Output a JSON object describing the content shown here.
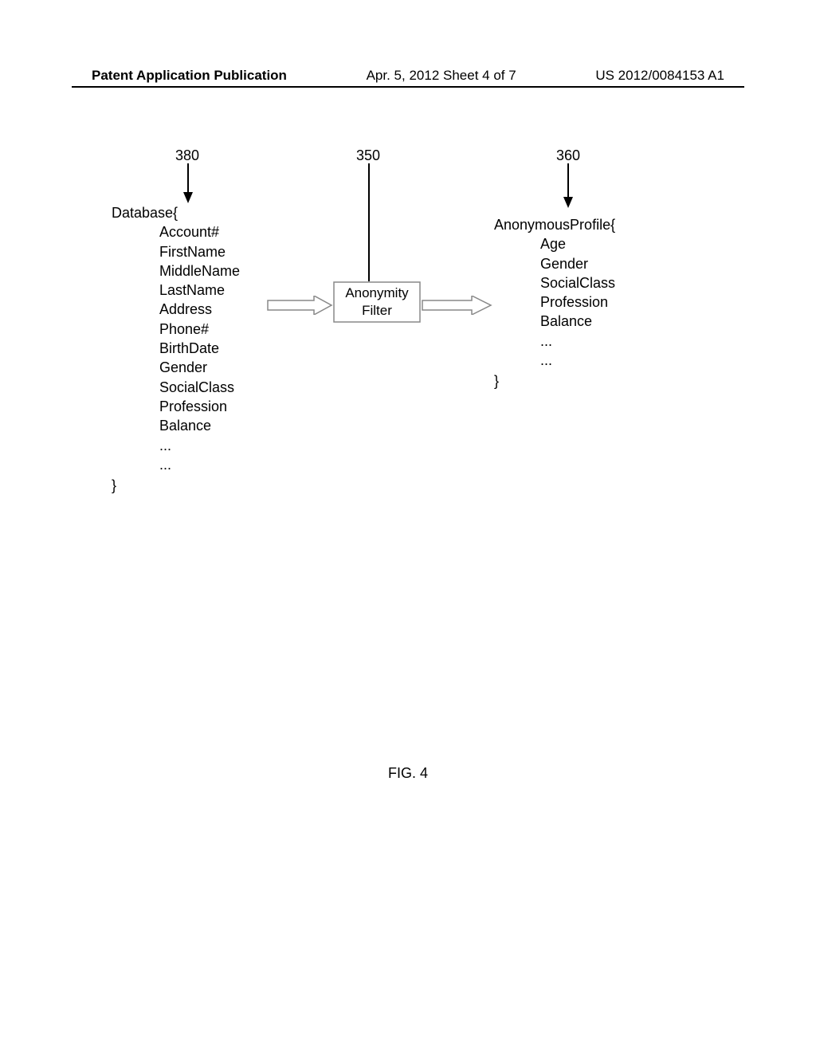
{
  "header": {
    "left": "Patent Application Publication",
    "center": "Apr. 5, 2012  Sheet 4 of 7",
    "right": "US 2012/0084153 A1"
  },
  "refs": {
    "r380": "380",
    "r350": "350",
    "r360": "360"
  },
  "database": {
    "title": "Database{",
    "fields": [
      "Account#",
      "FirstName",
      "MiddleName",
      "LastName",
      "Address",
      "Phone#",
      "BirthDate",
      "Gender",
      "SocialClass",
      "Profession",
      "Balance",
      "...",
      "..."
    ],
    "close": "}"
  },
  "filter": {
    "line1": "Anonymity",
    "line2": "Filter"
  },
  "anon": {
    "title": "AnonymousProfile{",
    "fields": [
      "Age",
      "Gender",
      "SocialClass",
      "Profession",
      "Balance",
      "...",
      "..."
    ],
    "close": "}"
  },
  "caption": "FIG. 4"
}
